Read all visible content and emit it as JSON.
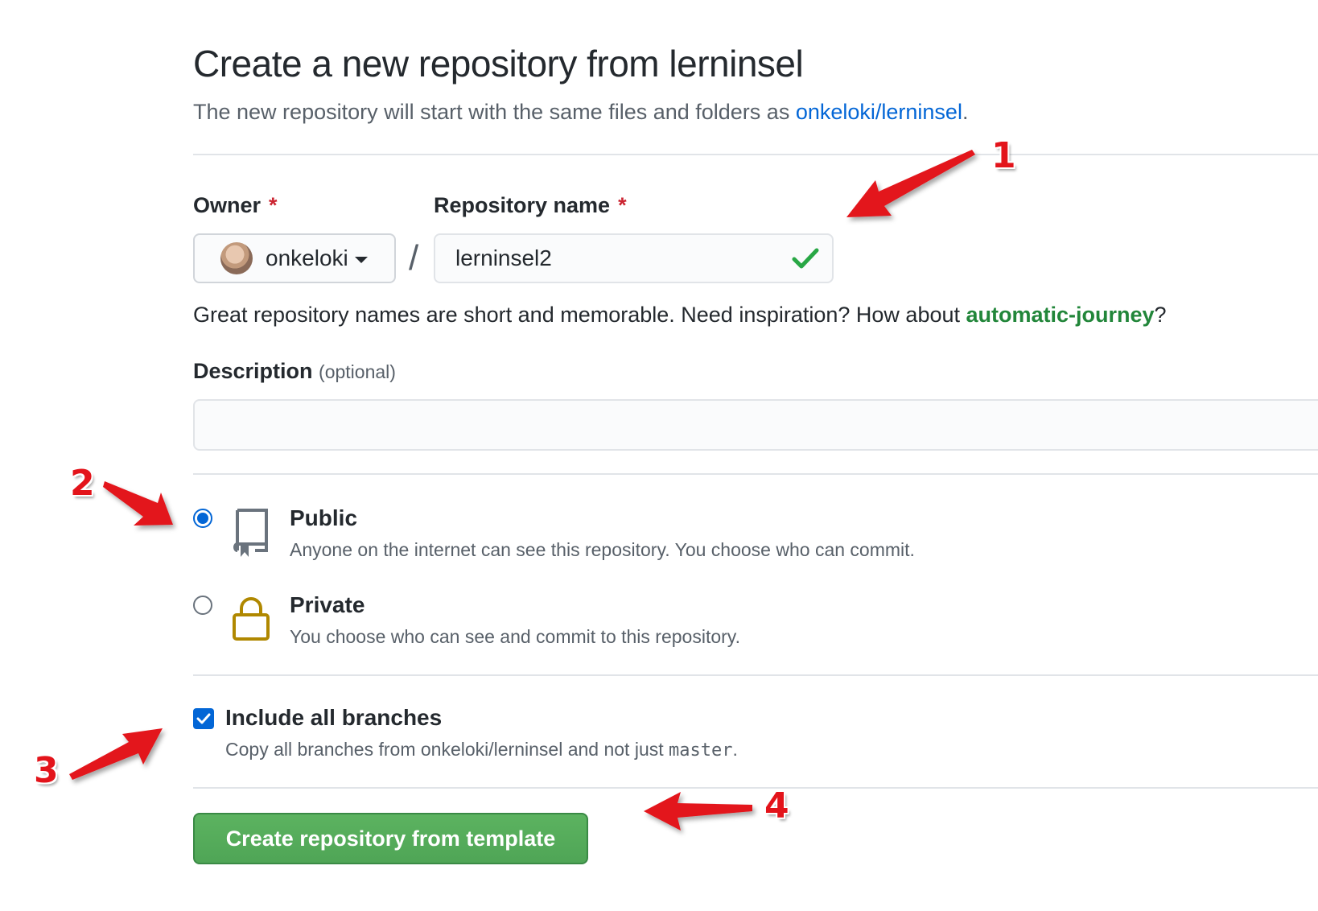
{
  "header": {
    "title": "Create a new repository from lerninsel",
    "subtitle_prefix": "The new repository will start with the same files and folders as ",
    "subtitle_link": "onkeloki/lerninsel",
    "subtitle_suffix": "."
  },
  "form": {
    "owner_label": "Owner",
    "repo_label": "Repository name",
    "required_marker": "*",
    "owner_value": "onkeloki",
    "separator": "/",
    "repo_value": "lerninsel2",
    "hint_prefix": "Great repository names are short and memorable. Need inspiration? How about ",
    "hint_suggestion": "automatic-journey",
    "hint_suffix": "?",
    "description_label": "Description",
    "description_optional": "(optional)",
    "description_value": ""
  },
  "visibility": {
    "public": {
      "title": "Public",
      "desc": "Anyone on the internet can see this repository. You choose who can commit.",
      "selected": true
    },
    "private": {
      "title": "Private",
      "desc": "You choose who can see and commit to this repository.",
      "selected": false
    }
  },
  "branches": {
    "label": "Include all branches",
    "desc_prefix": "Copy all branches from onkeloki/lerninsel and not just ",
    "desc_code": "master",
    "desc_suffix": ".",
    "checked": true
  },
  "submit": {
    "label": "Create repository from template"
  },
  "annotations": {
    "marker1": "1",
    "marker2": "2",
    "marker3": "3",
    "marker4": "4",
    "color": "#e3141b"
  },
  "colors": {
    "link": "#0366d6",
    "success": "#22863a",
    "button": "#4fa556",
    "required": "#cb2431"
  }
}
